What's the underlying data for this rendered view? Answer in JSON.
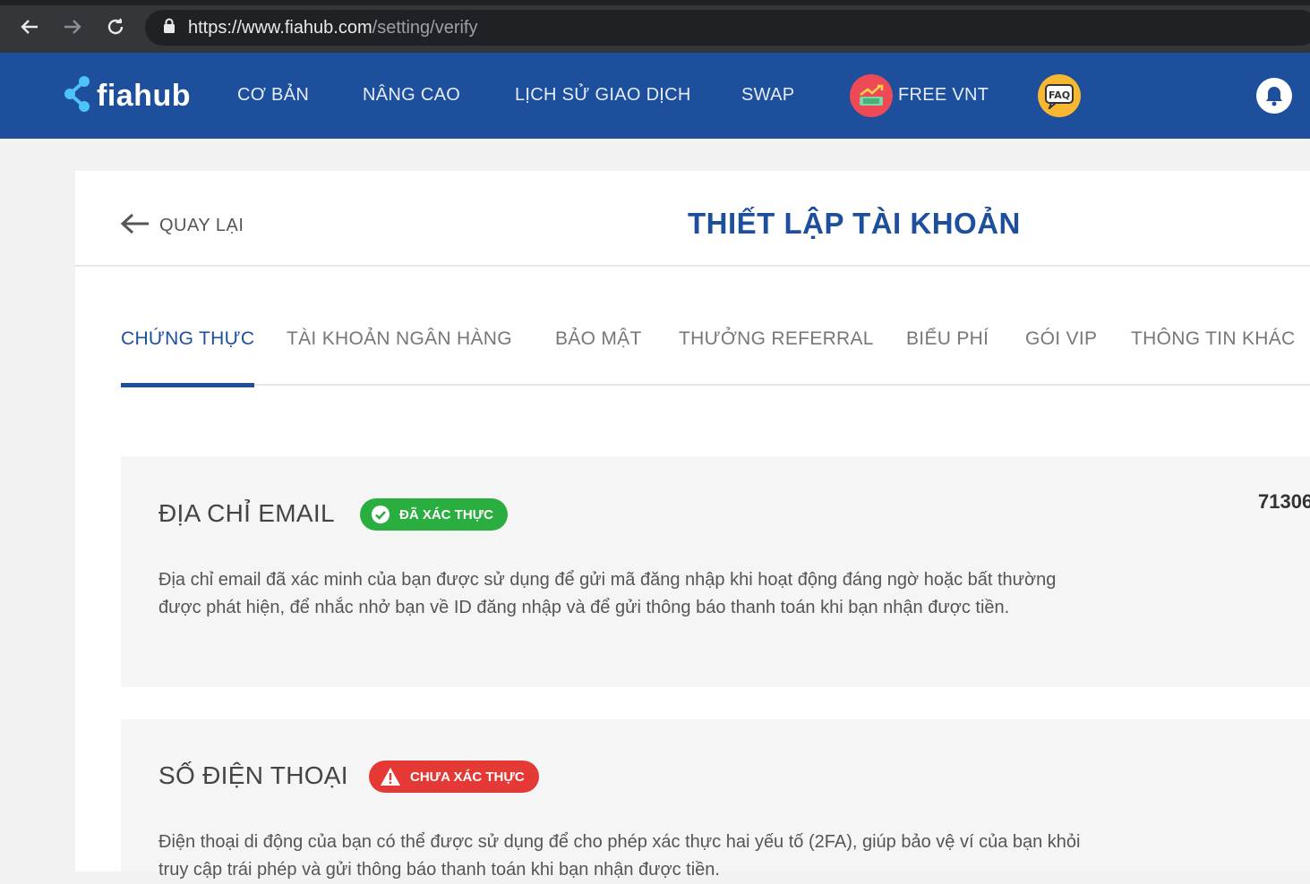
{
  "browser": {
    "url_host": "https://www.fiahub.com",
    "url_path": "/setting/verify"
  },
  "header": {
    "logo_text": "fiahub",
    "nav": [
      "CƠ BẢN",
      "NÂNG CAO",
      "LỊCH SỬ GIAO DỊCH",
      "SWAP",
      "FREE VNT"
    ],
    "faq_label": "FAQ"
  },
  "page": {
    "back_label": "QUAY LẠI",
    "title": "THIẾT LẬP TÀI KHOẢN"
  },
  "tabs": [
    {
      "label": "CHỨNG THỰC",
      "active": true
    },
    {
      "label": "TÀI KHOẢN NGÂN HÀNG"
    },
    {
      "label": "BẢO MẬT"
    },
    {
      "label": "THƯỞNG REFERRAL"
    },
    {
      "label": "BIỂU PHÍ"
    },
    {
      "label": "GÓI VIP"
    },
    {
      "label": "THÔNG TIN KHÁC"
    }
  ],
  "sections": {
    "email": {
      "title": "ĐỊA CHỈ EMAIL",
      "badge": "ĐÃ XÁC THỰC",
      "description": "Địa chỉ email đã xác minh của bạn được sử dụng để gửi mã đăng nhập khi hoạt động đáng ngờ hoặc bất thường được phát hiện, để nhắc nhở bạn về ID đăng nhập và để gửi thông báo thanh toán khi bạn nhận được tiền.",
      "side_value": "71306"
    },
    "phone": {
      "title": "SỐ ĐIỆN THOẠI",
      "badge": "CHƯA XÁC THỰC",
      "description": "Điện thoại di động của bạn có thể được sử dụng để cho phép xác thực hai yếu tố (2FA), giúp bảo vệ ví của bạn khỏi truy cập trái phép và gửi thông báo thanh toán khi bạn nhận được tiền."
    }
  },
  "colors": {
    "brand": "#1d4f9c",
    "verified": "#2aae3f",
    "unverified": "#e53935"
  }
}
